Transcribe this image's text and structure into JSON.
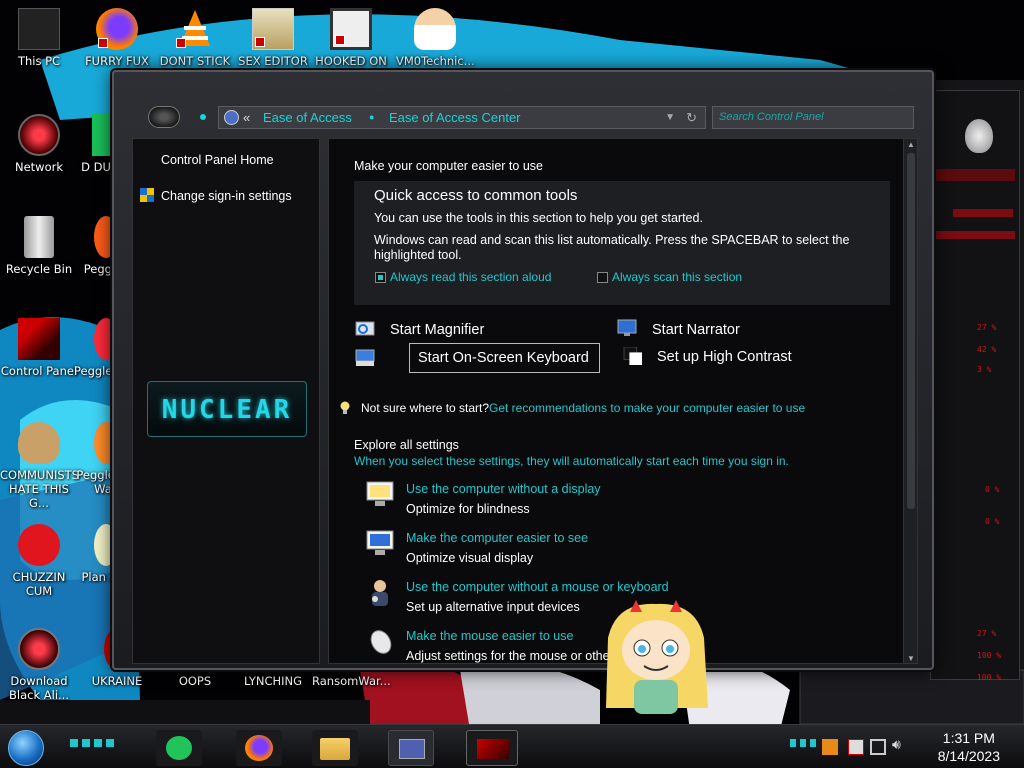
{
  "desktop": {
    "icons": [
      {
        "label": "This PC"
      },
      {
        "label": "FURRY FUX"
      },
      {
        "label": "DONT STICK"
      },
      {
        "label": "SEX EDITOR"
      },
      {
        "label": "HOOKED ON"
      },
      {
        "label": "VM0Technic..."
      },
      {
        "label": "Network"
      },
      {
        "label": "D DUM"
      },
      {
        "label": "Recycle Bin"
      },
      {
        "label": "Peggle"
      },
      {
        "label": "Control Panel"
      },
      {
        "label": "Peggle De"
      },
      {
        "label": "COMMUNISTS HATE THIS G..."
      },
      {
        "label": "Peggle of Wa"
      },
      {
        "label": "CHUZZIN CUM"
      },
      {
        "label": "Plan Zo"
      },
      {
        "label": "Download Black Ali..."
      },
      {
        "label": "UKRAINE"
      },
      {
        "label": "OOPS"
      },
      {
        "label": "LYNCHING"
      },
      {
        "label": "RansomWar..."
      }
    ]
  },
  "window": {
    "breadcrumb": {
      "back_chevron": "«",
      "crumb1": "Ease of Access",
      "crumb2": "Ease of Access Center"
    },
    "search_placeholder": "Search Control Panel",
    "left_pane": {
      "home_link": "Control Panel Home",
      "signin_link": "Change sign-in settings",
      "logo_text": "NUCLEAR"
    },
    "content": {
      "heading": "Make your computer easier to use",
      "quick_access": {
        "title": "Quick access to common tools",
        "desc1": "You can use the tools in this section to help you get started.",
        "desc2": "Windows can read and scan this list automatically.  Press the SPACEBAR to select the",
        "desc2b": "highlighted tool.",
        "check_read": "Always read this section aloud",
        "check_scan": "Always scan this section",
        "check_read_on": true,
        "check_scan_on": false
      },
      "tools": {
        "magnifier": "Start Magnifier",
        "narrator": "Start Narrator",
        "osk": "Start On-Screen Keyboard",
        "contrast": "Set up High Contrast"
      },
      "not_sure": "Not sure where to start?",
      "recommend_link": "Get recommendations to make your computer easier to use",
      "explore_title": "Explore all settings",
      "explore_desc": "When you select these settings, they will automatically start each time you sign in.",
      "settings": [
        {
          "link": "Use the computer without a display",
          "desc": "Optimize for blindness"
        },
        {
          "link": "Make the computer easier to see",
          "desc": "Optimize visual display"
        },
        {
          "link": "Use the computer without a mouse or keyboard",
          "desc": "Set up alternative input devices"
        },
        {
          "link": "Make the mouse easier to use",
          "desc": "Adjust settings for the mouse or other p                    s"
        }
      ]
    }
  },
  "gadgets": {
    "readouts": [
      "27 %",
      "42 %",
      "3 %",
      "0 %",
      "0 %",
      "27 %",
      "100 %",
      "100 %"
    ]
  },
  "taskbar": {
    "time": "1:31 PM",
    "date": "8/14/2023"
  },
  "colors": {
    "accent_cyan": "#1fc8cf",
    "frame": "#2e2f35",
    "wallpaper_red": "#d0131a"
  }
}
